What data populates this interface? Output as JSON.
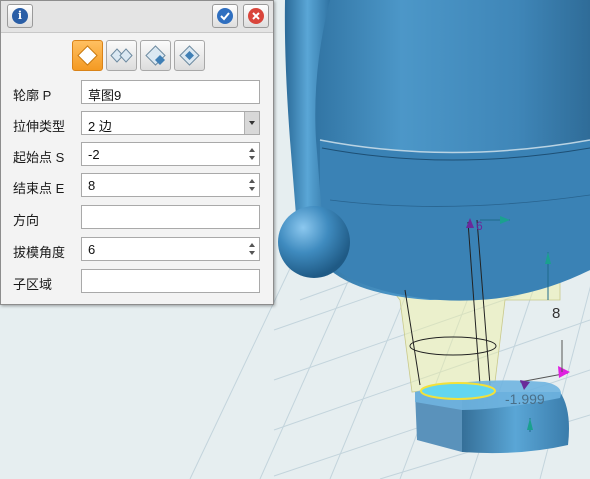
{
  "panel": {
    "modes": [
      {
        "icon": "diamond-extrude-icon",
        "active": true
      },
      {
        "icon": "diamond-both-sides-icon",
        "active": false
      },
      {
        "icon": "diamond-add-icon",
        "active": false
      },
      {
        "icon": "diamond-subtract-icon",
        "active": false
      }
    ],
    "fields": [
      {
        "label": "轮廓 P",
        "value": "草图9",
        "control": "text"
      },
      {
        "label": "拉伸类型",
        "value": "2 边",
        "control": "dropdown"
      },
      {
        "label": "起始点 S",
        "value": "-2",
        "control": "spinner"
      },
      {
        "label": "结束点 E",
        "value": "8",
        "control": "spinner"
      },
      {
        "label": "方向",
        "value": "",
        "control": "text"
      },
      {
        "label": "拔模角度",
        "value": "6",
        "control": "spinner"
      },
      {
        "label": "子区域",
        "value": "",
        "control": "text"
      }
    ]
  },
  "viewport": {
    "dimensions": {
      "end_value": "8",
      "start_value": "-1.999"
    },
    "colors": {
      "model": "#3f86b8",
      "preview": "#f2f2a0",
      "grid": "#c3d4dc",
      "handle": "#e020e0"
    }
  }
}
